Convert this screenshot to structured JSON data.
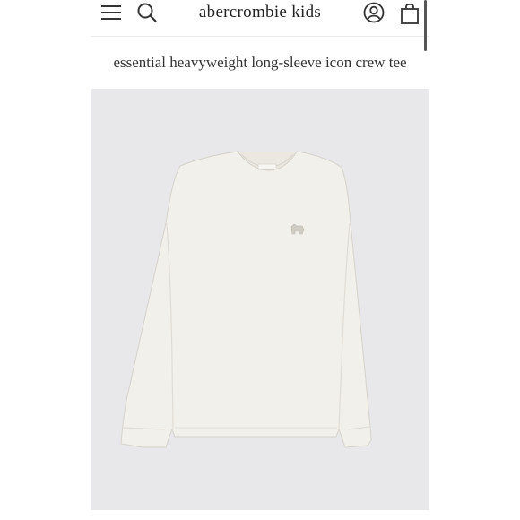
{
  "header": {
    "brand": "abercrombie kids",
    "icons": [
      "menu-icon",
      "search-icon",
      "account-icon",
      "shopping-bag-icon"
    ]
  },
  "product": {
    "title": "essential heavyweight long-sleeve icon crew tee",
    "image_alt": "long-sleeve crew tee in off-white"
  },
  "colors": {
    "background": "#ffffff",
    "image_background": "#e8e7e9",
    "shirt": "#f2f0ea",
    "text": "#222222"
  }
}
